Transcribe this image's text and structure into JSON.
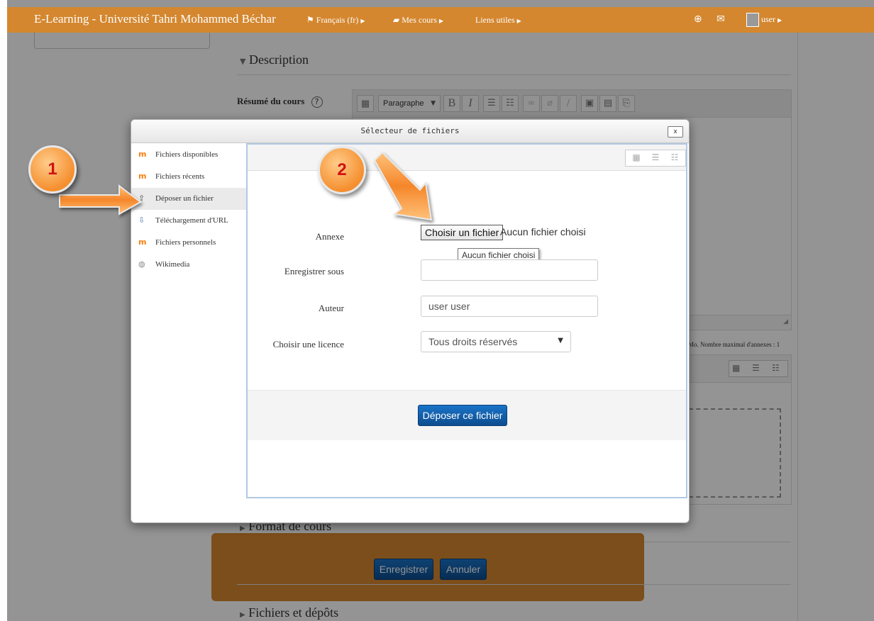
{
  "navbar": {
    "brand": "E-Learning - Université Tahri Mohammed Béchar",
    "language": "Français (fr)",
    "my_courses": "Mes cours",
    "useful_links": "Liens utiles",
    "user": "user",
    "color": "#d4872f"
  },
  "background": {
    "section_description": "Description",
    "summary_label": "Résumé du cours",
    "paragraph_select": "Paragraphe",
    "bold": "B",
    "italic": "I",
    "max_files_text": "Mo. Nombre maximal d'annexes : 1",
    "section_format": "Format de cours",
    "section_files": "Fichiers et dépôts",
    "save_button": "Enregistrer",
    "cancel_button": "Annuler"
  },
  "dialog": {
    "title": "Sélecteur de fichiers",
    "close": "x",
    "repositories": [
      {
        "label": "Fichiers disponibles",
        "icon": "moodle-icon"
      },
      {
        "label": "Fichiers récents",
        "icon": "moodle-icon"
      },
      {
        "label": "Déposer un fichier",
        "icon": "upload-icon",
        "active": true
      },
      {
        "label": "Téléchargement d'URL",
        "icon": "url-download-icon"
      },
      {
        "label": "Fichiers personnels",
        "icon": "moodle-icon"
      },
      {
        "label": "Wikimedia",
        "icon": "wikimedia-icon"
      }
    ],
    "form": {
      "attachment_label": "Annexe",
      "choose_file_button": "Choisir un fichier",
      "no_file_text": "Aucun fichier choisi",
      "tooltip": "Aucun fichier choisi",
      "save_as_label": "Enregistrer sous",
      "save_as_value": "",
      "author_label": "Auteur",
      "author_value": "user user",
      "license_label": "Choisir une licence",
      "license_value": "Tous droits réservés",
      "upload_button": "Déposer ce fichier"
    }
  },
  "annotations": {
    "step1": "1",
    "step2": "2",
    "color": "#f58f2f"
  }
}
